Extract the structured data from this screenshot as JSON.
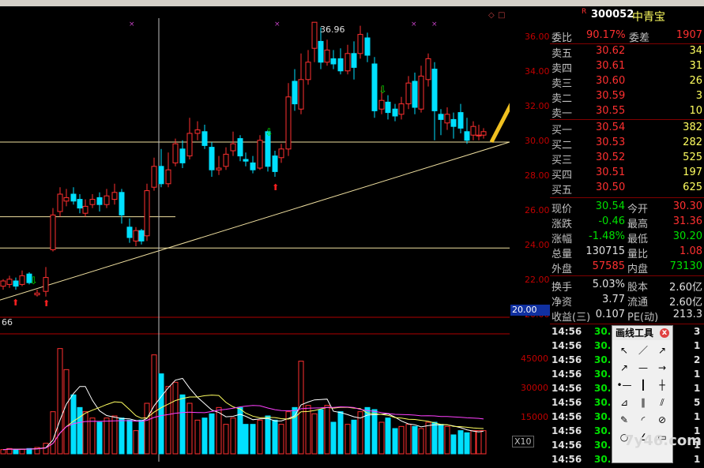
{
  "stock": {
    "code": "300052",
    "name": "中青宝",
    "flag": "R"
  },
  "axis": {
    "price_ticks": [
      "36.00",
      "34.00",
      "32.00",
      "30.00",
      "28.00",
      "26.00",
      "24.00",
      "22.00",
      "20.00"
    ],
    "vol_ticks": [
      "45000",
      "30000",
      "15000"
    ],
    "x10_label": "X10",
    "left_edge_label": "66",
    "peak_label": "36.96",
    "price_tag": "20.00"
  },
  "quote": {
    "weibi": {
      "label": "委比",
      "value": "90.17%",
      "label2": "委差",
      "value2": "1907"
    },
    "sells": [
      {
        "label": "卖五",
        "price": "30.62",
        "vol": "34"
      },
      {
        "label": "卖四",
        "price": "30.61",
        "vol": "31"
      },
      {
        "label": "卖三",
        "price": "30.60",
        "vol": "26"
      },
      {
        "label": "卖二",
        "price": "30.59",
        "vol": "3"
      },
      {
        "label": "卖一",
        "price": "30.55",
        "vol": "10"
      }
    ],
    "buys": [
      {
        "label": "买一",
        "price": "30.54",
        "vol": "382"
      },
      {
        "label": "买二",
        "price": "30.53",
        "vol": "282"
      },
      {
        "label": "买三",
        "price": "30.52",
        "vol": "525"
      },
      {
        "label": "买四",
        "price": "30.51",
        "vol": "197"
      },
      {
        "label": "买五",
        "price": "30.50",
        "vol": "625"
      }
    ],
    "stats": [
      {
        "l1": "现价",
        "v1": "30.54",
        "l2": "今开",
        "v2": "30.30",
        "c1": "green",
        "c2": "val"
      },
      {
        "l1": "涨跌",
        "v1": "-0.46",
        "l2": "最高",
        "v2": "31.36",
        "c1": "green",
        "c2": "val"
      },
      {
        "l1": "涨幅",
        "v1": "-1.48%",
        "l2": "最低",
        "v2": "30.20",
        "c1": "green",
        "c2": "green"
      },
      {
        "l1": "总量",
        "v1": "130715",
        "l2": "量比",
        "v2": "1.08",
        "c1": "white",
        "c2": "val"
      },
      {
        "l1": "外盘",
        "v1": "57585",
        "l2": "内盘",
        "v2": "73130",
        "c1": "val",
        "c2": "green"
      }
    ],
    "fin": [
      {
        "l1": "换手",
        "v1": "5.03%",
        "l2": "股本",
        "v2": "2.60亿"
      },
      {
        "l1": "净资",
        "v1": "3.77",
        "l2": "流通",
        "v2": "2.60亿"
      },
      {
        "l1": "收益(三)",
        "v1": "0.107",
        "l2": "PE(动)",
        "v2": "213.3"
      }
    ]
  },
  "ticks": [
    {
      "time": "14:56",
      "price": "30.",
      "num": "3"
    },
    {
      "time": "14:56",
      "price": "30.",
      "num": "1"
    },
    {
      "time": "14:56",
      "price": "30.",
      "num": "2"
    },
    {
      "time": "14:56",
      "price": "30.",
      "num": "1"
    },
    {
      "time": "14:56",
      "price": "30.",
      "num": "1"
    },
    {
      "time": "14:56",
      "price": "30.",
      "num": "5"
    },
    {
      "time": "14:56",
      "price": "30.",
      "num": "1"
    },
    {
      "time": "14:56",
      "price": "30.",
      "num": "1"
    },
    {
      "time": "14:56",
      "price": "30.",
      "num": "1"
    },
    {
      "time": "14:56",
      "price": "30.",
      "num": "1"
    }
  ],
  "tool_window": {
    "title": "画线工具",
    "close": "x"
  },
  "watermark": "7y46.com",
  "colors": {
    "up": "#ff3030",
    "down": "#00e0ff",
    "ma1": "#ffffff",
    "ma2": "#ffff60",
    "ma3": "#ff40ff",
    "hline": "#f0e0a0",
    "arrow": "#f0c020"
  }
}
